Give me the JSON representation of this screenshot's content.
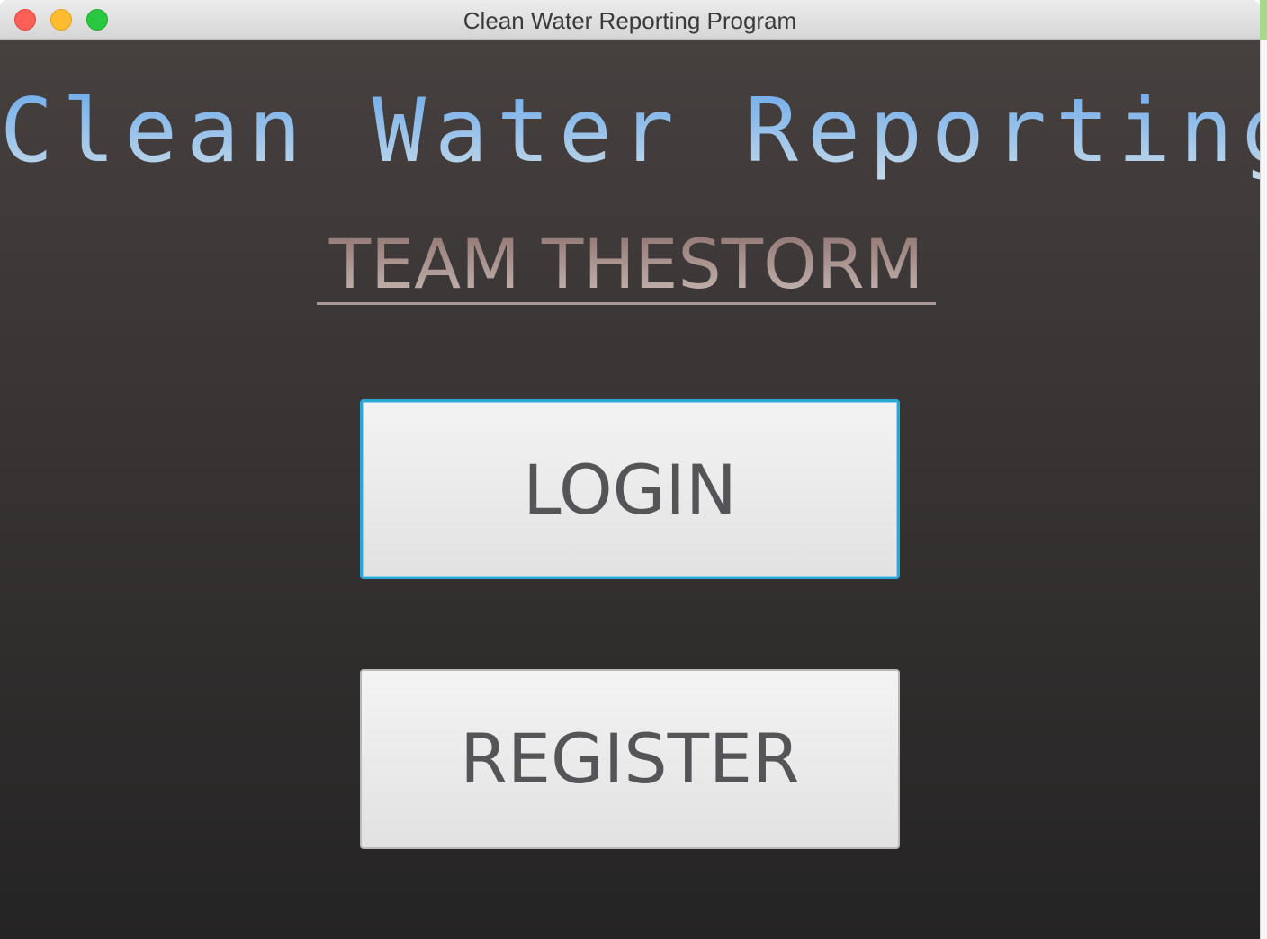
{
  "window": {
    "title": "Clean Water Reporting Program",
    "controls": [
      "close",
      "minimize",
      "zoom"
    ]
  },
  "main": {
    "app_title": "Clean Water Reporting",
    "team_title": "TEAM THESTORM",
    "login_label": "LOGIN",
    "register_label": "REGISTER"
  },
  "colors": {
    "background_top": "#46403f",
    "background_bottom": "#252424",
    "title_gradient_top": "#6aa9ec",
    "title_gradient_bottom": "#c8dbe8",
    "team_gradient_top": "#8c6f6d",
    "team_gradient_bottom": "#c9bcb6",
    "focus_ring": "#2ba7d6"
  }
}
